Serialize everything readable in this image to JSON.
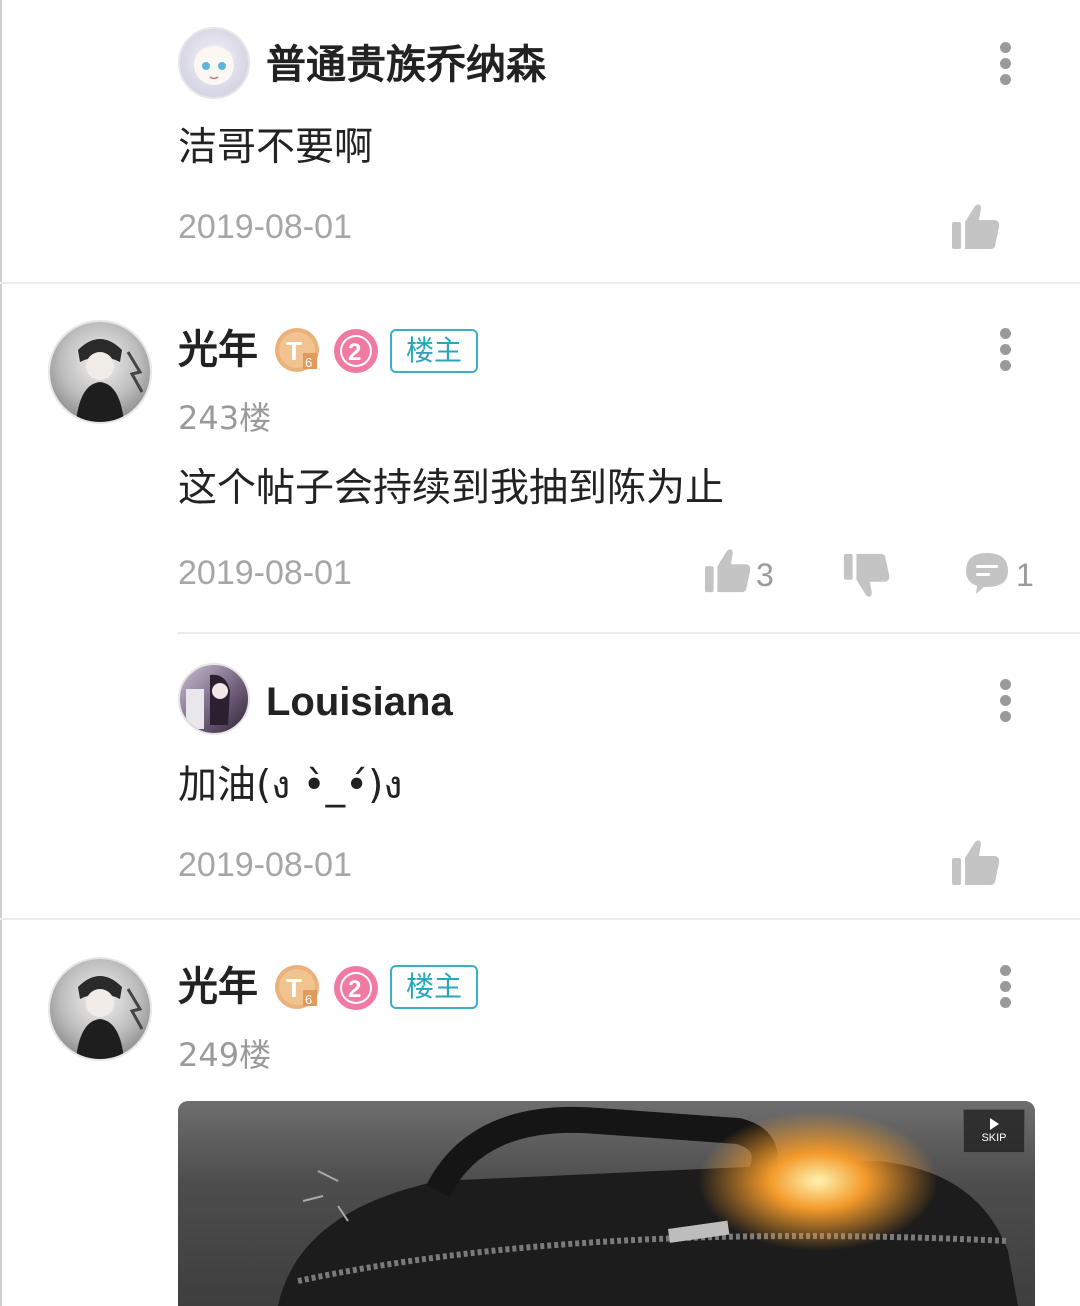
{
  "comments": [
    {
      "username": "普通贵族乔纳森",
      "text": "洁哥不要啊",
      "date": "2019-08-01"
    },
    {
      "username": "光年",
      "level_badge": "T6",
      "rank_badge": "2",
      "owner_badge": "楼主",
      "floor": "243楼",
      "text": "这个帖子会持续到我抽到陈为止",
      "date": "2019-08-01",
      "likes": "3",
      "replies": "1",
      "reply": {
        "username": "Louisiana",
        "text": "加油(ง •̀_•́)ง",
        "date": "2019-08-01"
      }
    },
    {
      "username": "光年",
      "level_badge": "T6",
      "rank_badge": "2",
      "owner_badge": "楼主",
      "floor": "249楼",
      "media": {
        "skip_label": "SKIP"
      }
    }
  ],
  "colors": {
    "owner_badge": "#2aa6bb",
    "level_badge": "#e9b07a",
    "rank_badge": "#f07aa2",
    "meta_text": "#a6a6a6"
  },
  "icons": [
    "more-vertical-icon",
    "thumbs-up-icon",
    "thumbs-down-icon",
    "comment-icon",
    "play-icon"
  ]
}
